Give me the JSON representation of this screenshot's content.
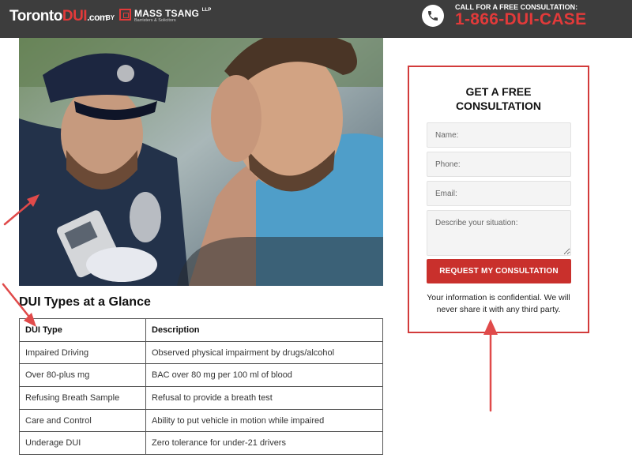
{
  "header": {
    "logo_main": "Toronto",
    "logo_accent": "DUI",
    "logo_suffix": ".com",
    "by_label": "BY",
    "firm_name": "MASS TSANG",
    "firm_llp": "LLP",
    "firm_tagline": "Barristers & Solicitors",
    "call_label": "CALL FOR A FREE CONSULTATION:",
    "phone_number": "1-866-DUI-CASE"
  },
  "hero": {
    "icon": "traffic-stop-photo"
  },
  "section": {
    "title": "DUI Types at a Glance"
  },
  "table": {
    "headers": [
      "DUI Type",
      "Description"
    ],
    "rows": [
      [
        "Impaired Driving",
        "Observed physical impairment by drugs/alcohol"
      ],
      [
        "Over 80-plus mg",
        "BAC over 80 mg per 100 ml of blood"
      ],
      [
        "Refusing Breath Sample",
        "Refusal to provide a breath test"
      ],
      [
        "Care and Control",
        "Ability to put vehicle in motion while impaired"
      ],
      [
        "Underage DUI",
        "Zero tolerance for under-21 drivers"
      ]
    ]
  },
  "form": {
    "title_line1": "GET A FREE",
    "title_line2": "CONSULTATION",
    "name_placeholder": "Name:",
    "phone_placeholder": "Phone:",
    "email_placeholder": "Email:",
    "situation_placeholder": "Describe your situation:",
    "submit_label": "REQUEST MY CONSULTATION",
    "privacy_note": "Your information is confidential. We will never share it with any third party."
  },
  "colors": {
    "accent_red": "#e23a3a",
    "button_red": "#c9302c",
    "header_bg": "#3d3d3d",
    "annotation_red": "#e04a4a"
  }
}
